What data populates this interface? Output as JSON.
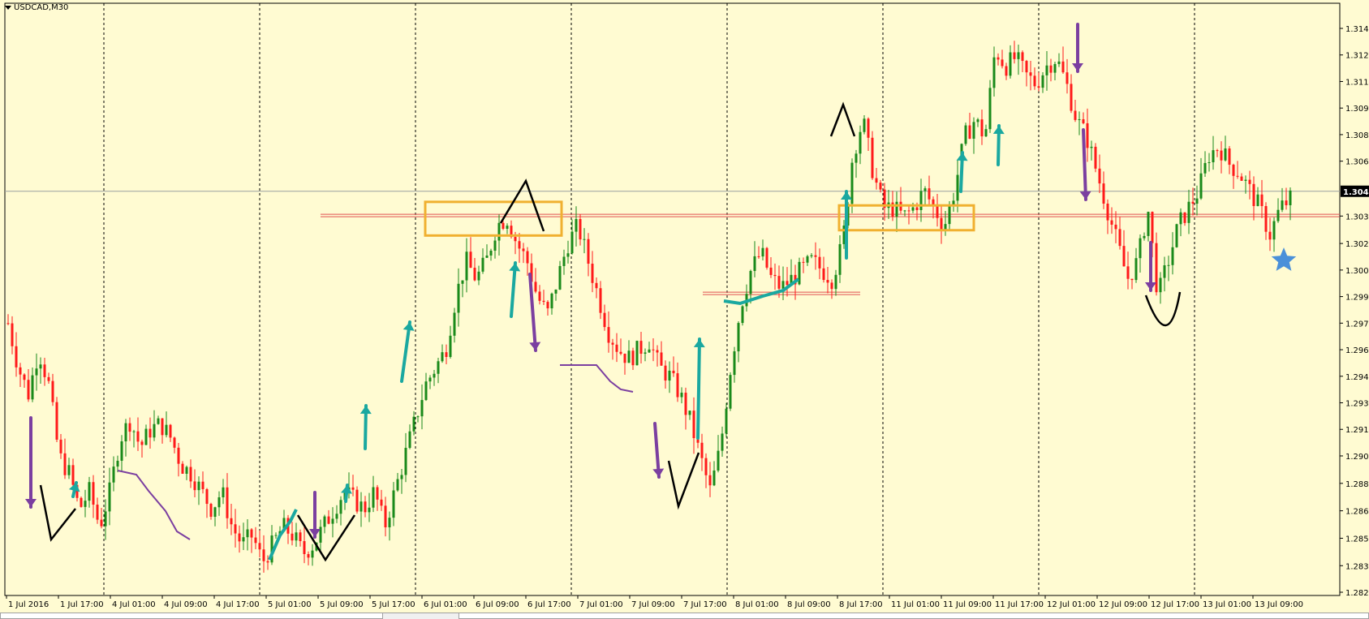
{
  "window": {
    "symbol_title": "USDCAD,M30"
  },
  "colors": {
    "background": "#fffbd2",
    "bull": "#1a8a1a",
    "bear": "#ff1a1a",
    "current_price_tag": "#000000",
    "purple_arrow": "#7b3fa0",
    "teal_arrow": "#1aa8a0",
    "box_outline": "#f0b030",
    "zone_line": "#e05050"
  },
  "price_axis": {
    "ticks": [
      "1.31415",
      "1.31265",
      "1.31115",
      "1.30965",
      "1.30815",
      "1.30665",
      "1.30355",
      "1.30200",
      "1.30050",
      "1.29900",
      "1.29750",
      "1.29600",
      "1.29450",
      "1.29300",
      "1.29150",
      "1.29000",
      "1.28845",
      "1.28690",
      "1.28535",
      "1.28380",
      "1.28230"
    ],
    "current_price": "1.30495"
  },
  "time_axis": {
    "ticks": [
      "1 Jul 2016",
      "1 Jul 17:00",
      "4 Jul 01:00",
      "4 Jul 09:00",
      "4 Jul 17:00",
      "5 Jul 01:00",
      "5 Jul 09:00",
      "5 Jul 17:00",
      "6 Jul 01:00",
      "6 Jul 09:00",
      "6 Jul 17:00",
      "7 Jul 01:00",
      "7 Jul 09:00",
      "7 Jul 17:00",
      "8 Jul 01:00",
      "8 Jul 09:00",
      "8 Jul 17:00",
      "11 Jul 01:00",
      "11 Jul 09:00",
      "11 Jul 17:00",
      "12 Jul 01:00",
      "12 Jul 09:00",
      "12 Jul 17:00",
      "13 Jul 01:00",
      "13 Jul 09:00"
    ]
  },
  "chart_data": {
    "type": "candlestick",
    "symbol": "USDCAD",
    "timeframe": "M30",
    "ylim": [
      1.2823,
      1.3149
    ],
    "current_price": 1.30495,
    "price_path": [
      1.2975,
      1.295,
      1.2935,
      1.296,
      1.294,
      1.29,
      1.289,
      1.287,
      1.288,
      1.286,
      1.288,
      1.291,
      1.292,
      1.2905,
      1.2915,
      1.2918,
      1.291,
      1.2895,
      1.289,
      1.288,
      1.287,
      1.288,
      1.286,
      1.285,
      1.2855,
      1.284,
      1.285,
      1.286,
      1.2855,
      1.2845,
      1.285,
      1.286,
      1.287,
      1.288,
      1.2875,
      1.287,
      1.288,
      1.286,
      1.288,
      1.29,
      1.292,
      1.294,
      1.295,
      1.296,
      1.299,
      1.301,
      1.3,
      1.301,
      1.303,
      1.3035,
      1.302,
      1.301,
      1.299,
      1.298,
      1.3,
      1.302,
      1.303,
      1.301,
      1.299,
      1.297,
      1.296,
      1.2955,
      1.296,
      1.2965,
      1.295,
      1.2945,
      1.2935,
      1.292,
      1.29,
      1.288,
      1.2905,
      1.295,
      1.2985,
      1.3005,
      1.3015,
      1.3,
      1.2995,
      1.3,
      1.3005,
      1.301,
      1.3005,
      1.3,
      1.302,
      1.307,
      1.309,
      1.306,
      1.304,
      1.304,
      1.3035,
      1.304,
      1.305,
      1.304,
      1.303,
      1.305,
      1.308,
      1.309,
      1.308,
      1.313,
      1.312,
      1.3125,
      1.3115,
      1.311,
      1.312,
      1.3125,
      1.311,
      1.309,
      1.308,
      1.306,
      1.304,
      1.302,
      1.3,
      1.301,
      1.304,
      1.299,
      1.301,
      1.303,
      1.304,
      1.305,
      1.307,
      1.3075,
      1.3065,
      1.306,
      1.305,
      1.304,
      1.3025,
      1.304,
      1.3045
    ],
    "annotations": [
      {
        "type": "horizontal_line",
        "price": 1.3037,
        "color": "zone_line"
      },
      {
        "type": "horizontal_line",
        "price": 1.30495,
        "color": "current_price_line"
      },
      {
        "type": "box",
        "from_price": 1.3028,
        "to_price": 1.3048,
        "color": "box_outline"
      },
      {
        "type": "box",
        "from_price": 1.3028,
        "to_price": 1.3042,
        "color": "box_outline"
      },
      {
        "type": "marker",
        "shape": "star",
        "color": "#4a90d9"
      }
    ]
  }
}
